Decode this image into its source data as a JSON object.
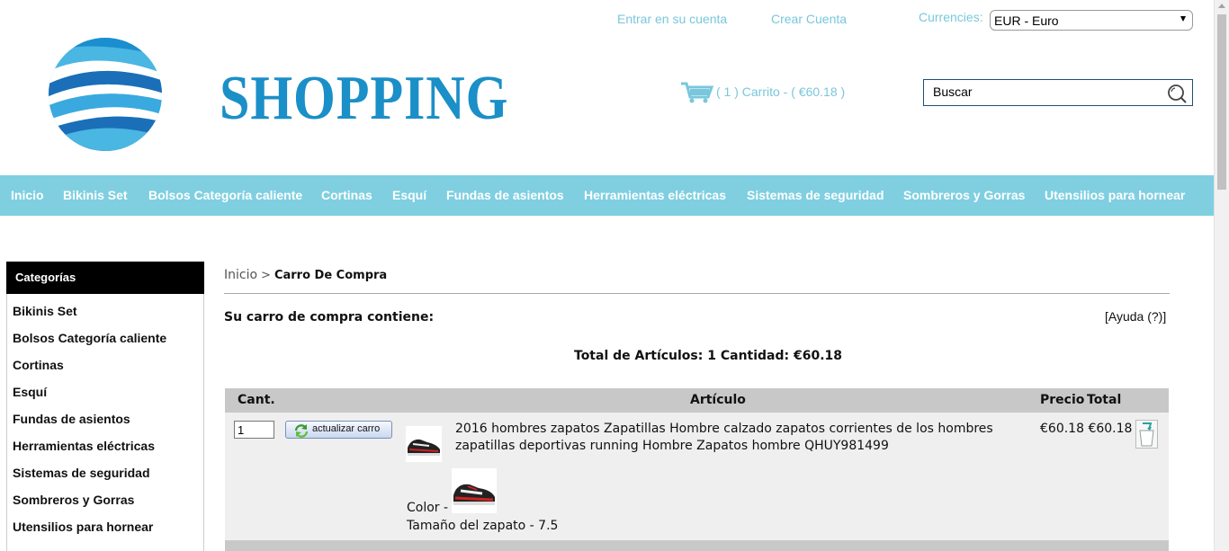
{
  "header": {
    "login_link": "Entrar en su cuenta",
    "create_link": "Crear Cuenta",
    "currency_label": "Currencies:",
    "currency_selected": "EUR - Euro",
    "logo_text": "SHOPPING",
    "cart_text": "( 1 ) Carrito - ( €60.18 )",
    "search_placeholder": "Buscar"
  },
  "nav": {
    "items": [
      "Inicio",
      "Bikinis Set",
      "Bolsos Categoría caliente",
      "Cortinas",
      "Esquí",
      "Fundas de asientos",
      "Herramientas eléctricas",
      "Sistemas de seguridad",
      "Sombreros y Gorras",
      "Utensilios para hornear"
    ]
  },
  "sidebar": {
    "title": "Categorías",
    "items": [
      "Bikinis Set",
      "Bolsos Categoría caliente",
      "Cortinas",
      "Esquí",
      "Fundas de asientos",
      "Herramientas eléctricas",
      "Sistemas de seguridad",
      "Sombreros y Gorras",
      "Utensilios para hornear"
    ]
  },
  "breadcrumb": {
    "home": "Inicio",
    "separator": ">",
    "current": "Carro De Compra"
  },
  "cart": {
    "title": "Su carro de compra contiene:",
    "help": "[Ayuda (?)]",
    "totals": "Total de Artículos: 1   Cantidad: €60.18",
    "columns": {
      "qty": "Cant.",
      "item": "Artículo",
      "price": "Precio",
      "total": "Total"
    },
    "rows": [
      {
        "qty": "1",
        "update_label": "actualizar carro",
        "description": "2016 hombres zapatos Zapatillas Hombre calzado zapatos corrientes de los hombres zapatillas deportivas running Hombre Zapatos hombre QHUY981499",
        "color_attr": "Color -",
        "size_attr": "Tamaño del zapato - 7.5",
        "price": "€60.18",
        "total": "€60.18"
      }
    ]
  },
  "colors": {
    "nav_bg": "#7fcfe1",
    "link": "#79c7dc",
    "logo": "#1b8fc7"
  }
}
